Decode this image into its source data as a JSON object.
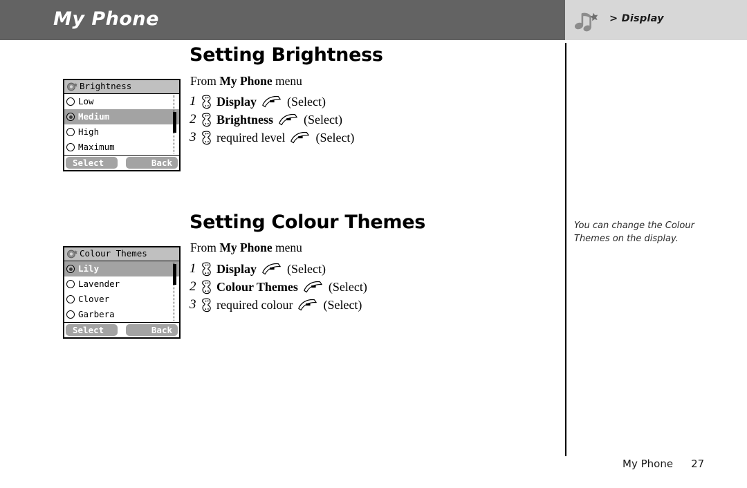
{
  "header": {
    "title": "My Phone",
    "breadcrumb": "> Display",
    "icon": "music-notes-icon",
    "dark_color": "#636363",
    "light_color": "#d7d7d7"
  },
  "sections": [
    {
      "title": "Setting Brightness",
      "from_prefix": "From ",
      "from_bold": "My Phone",
      "from_suffix": " menu",
      "steps": [
        {
          "num": "1",
          "label": "Display",
          "bold": true,
          "paren": "(Select)"
        },
        {
          "num": "2",
          "label": "Brightness",
          "bold": true,
          "paren": "(Select)"
        },
        {
          "num": "3",
          "label": "required level",
          "bold": false,
          "paren": "(Select)"
        }
      ],
      "phone": {
        "title": "Brightness",
        "rows": [
          {
            "label": "Low",
            "selected": false
          },
          {
            "label": "Medium",
            "selected": true
          },
          {
            "label": "High",
            "selected": false
          },
          {
            "label": "Maximum",
            "selected": false
          }
        ],
        "softkey_left": "Select",
        "softkey_right": "Back"
      }
    },
    {
      "title": "Setting Colour Themes",
      "from_prefix": "From ",
      "from_bold": "My Phone",
      "from_suffix": " menu",
      "steps": [
        {
          "num": "1",
          "label": "Display",
          "bold": true,
          "paren": "(Select)"
        },
        {
          "num": "2",
          "label": "Colour Themes",
          "bold": true,
          "paren": "(Select)"
        },
        {
          "num": "3",
          "label": "required colour",
          "bold": false,
          "paren": "(Select)"
        }
      ],
      "phone": {
        "title": "Colour Themes",
        "rows": [
          {
            "label": "Lily",
            "selected": true
          },
          {
            "label": "Lavender",
            "selected": false
          },
          {
            "label": "Clover",
            "selected": false
          },
          {
            "label": "Garbera",
            "selected": false
          }
        ],
        "softkey_left": "Select",
        "softkey_right": "Back"
      }
    }
  ],
  "side_note": {
    "text": "You can change the Colour Themes on the display."
  },
  "footer": {
    "label": "My Phone",
    "page": "27"
  },
  "icons": {
    "scroll_key": "scroll-key-icon",
    "soft_key": "soft-key-icon"
  }
}
